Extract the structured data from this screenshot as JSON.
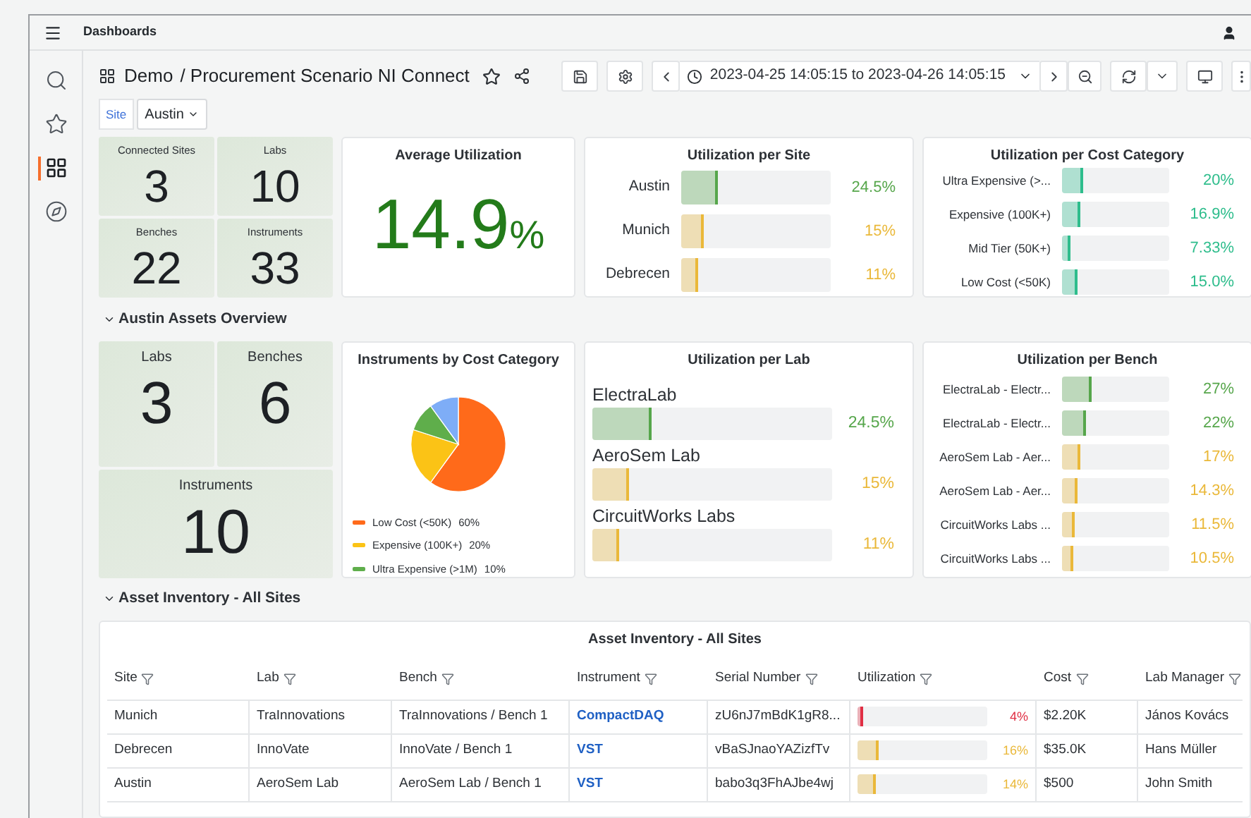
{
  "topbar": {
    "title": "Dashboards"
  },
  "sidebar": {
    "items": [
      {
        "kind": "search",
        "selected": false
      },
      {
        "kind": "starred",
        "selected": false
      },
      {
        "kind": "dashboards",
        "selected": true
      },
      {
        "kind": "explore",
        "selected": false
      }
    ]
  },
  "header": {
    "breadcrumb": [
      "Demo",
      "/ Procurement Scenario NI Connect"
    ],
    "time_range": "2023-04-25 14:05:15 to 2023-04-26 14:05:15"
  },
  "variables": [
    {
      "label": "Site",
      "value": "Austin"
    }
  ],
  "overview_stats": [
    {
      "label": "Connected Sites",
      "value": "3"
    },
    {
      "label": "Labs",
      "value": "10"
    },
    {
      "label": "Benches",
      "value": "22"
    },
    {
      "label": "Instruments",
      "value": "33"
    }
  ],
  "average_utilization": {
    "title": "Average Utilization",
    "value": "14.9",
    "unit": "%"
  },
  "utilization_per_site": {
    "title": "Utilization per Site",
    "bars": [
      {
        "label": "Austin",
        "reading": "24.5%",
        "level": 0.245,
        "color": "#56a64b"
      },
      {
        "label": "Munich",
        "reading": "15%",
        "level": 0.15,
        "color": "#eab839"
      },
      {
        "label": "Debrecen",
        "reading": "11%",
        "level": 0.11,
        "color": "#eab839"
      }
    ]
  },
  "utilization_per_cost_category": {
    "title": "Utilization per Cost Category",
    "bars": [
      {
        "label": "Ultra Expensive (>...",
        "reading": "20%",
        "level": 0.2,
        "color": "#2ebd8c"
      },
      {
        "label": "Expensive (100K+)",
        "reading": "16.9%",
        "level": 0.169,
        "color": "#2ebd8c"
      },
      {
        "label": "Mid Tier (50K+)",
        "reading": "7.33%",
        "level": 0.0733,
        "color": "#2ebd8c"
      },
      {
        "label": "Low Cost (<50K)",
        "reading": "15.0%",
        "level": 0.15,
        "color": "#2ebd8c"
      }
    ]
  },
  "sections": [
    {
      "title": "Austin Assets Overview"
    },
    {
      "title": "Asset Inventory - All Sites"
    }
  ],
  "site_stats": [
    {
      "label": "Labs",
      "value": "3"
    },
    {
      "label": "Benches",
      "value": "6"
    },
    {
      "label": "Instruments",
      "value": "10"
    }
  ],
  "instruments_by_cost": {
    "title": "Instruments by Cost Category",
    "chart_data": {
      "type": "pie",
      "values": [
        60,
        20,
        10,
        10
      ],
      "colors": [
        "#ff6a1a",
        "#fbc316",
        "#5fae4b",
        "#7eadf7"
      ]
    },
    "legend": [
      {
        "label": "Low Cost (<50K)",
        "value": "60%",
        "color": "#ff6a1a"
      },
      {
        "label": "Expensive (100K+)",
        "value": "20%",
        "color": "#fbc316"
      },
      {
        "label": "Ultra Expensive (>1M)",
        "value": "10%",
        "color": "#5fae4b"
      }
    ]
  },
  "utilization_per_lab": {
    "title": "Utilization per Lab",
    "bars": [
      {
        "label": "ElectraLab",
        "reading": "24.5%",
        "level": 0.245,
        "color": "#56a64b"
      },
      {
        "label": "AeroSem Lab",
        "reading": "15%",
        "level": 0.15,
        "color": "#eab839"
      },
      {
        "label": "CircuitWorks Labs",
        "reading": "11%",
        "level": 0.11,
        "color": "#eab839"
      }
    ]
  },
  "utilization_per_bench": {
    "title": "Utilization per Bench",
    "bars": [
      {
        "label": "ElectraLab - Electr...",
        "reading": "27%",
        "level": 0.27,
        "color": "#56a64b"
      },
      {
        "label": "ElectraLab - Electr...",
        "reading": "22%",
        "level": 0.22,
        "color": "#56a64b"
      },
      {
        "label": "AeroSem Lab - Aer...",
        "reading": "17%",
        "level": 0.17,
        "color": "#eab839"
      },
      {
        "label": "AeroSem Lab - Aer...",
        "reading": "14.3%",
        "level": 0.143,
        "color": "#eab839"
      },
      {
        "label": "CircuitWorks Labs ...",
        "reading": "11.5%",
        "level": 0.115,
        "color": "#eab839"
      },
      {
        "label": "CircuitWorks Labs ...",
        "reading": "10.5%",
        "level": 0.105,
        "color": "#eab839"
      }
    ]
  },
  "table": {
    "title": "Asset Inventory - All Sites",
    "columns": [
      "Site",
      "Lab",
      "Bench",
      "Instrument",
      "Serial Number",
      "Utilization",
      "Cost",
      "Lab Manager"
    ],
    "rows": [
      {
        "site": "Munich",
        "lab": "TraInnovations",
        "bench": "TraInnovations / Bench 1",
        "instrument": "CompactDAQ",
        "serial": "zU6nJ7mBdK1gR8...",
        "utilization": "4%",
        "level": 0.04,
        "color": "#e02f44",
        "cost": "$2.20K",
        "manager": "János Kovács"
      },
      {
        "site": "Debrecen",
        "lab": "InnoVate",
        "bench": "InnoVate / Bench 1",
        "instrument": "VST",
        "serial": "vBaSJnaoYAZizfTv",
        "utilization": "16%",
        "level": 0.16,
        "color": "#eab839",
        "cost": "$35.0K",
        "manager": "Hans Müller"
      },
      {
        "site": "Austin",
        "lab": "AeroSem Lab",
        "bench": "AeroSem Lab / Bench 1",
        "instrument": "VST",
        "serial": "babo3q3FhAJbe4wj",
        "utilization": "14%",
        "level": 0.14,
        "color": "#eab839",
        "cost": "$500",
        "manager": "John Smith"
      }
    ]
  }
}
